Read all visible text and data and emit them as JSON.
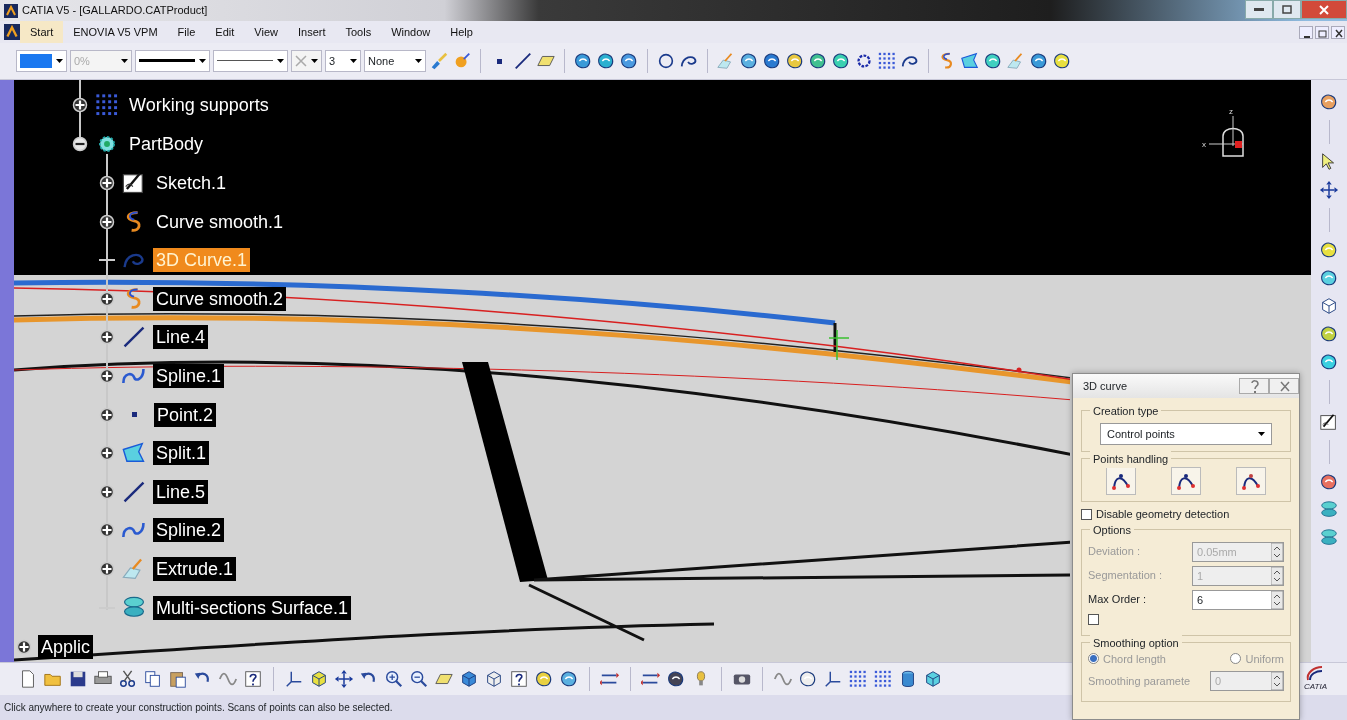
{
  "window": {
    "title": "CATIA V5 - [GALLARDO.CATProduct]"
  },
  "menu": [
    {
      "label": "Start",
      "selected": true
    },
    {
      "label": "ENOVIA V5 VPM",
      "selected": false
    },
    {
      "label": "File",
      "selected": false
    },
    {
      "label": "Edit",
      "selected": false
    },
    {
      "label": "View",
      "selected": false
    },
    {
      "label": "Insert",
      "selected": false
    },
    {
      "label": "Tools",
      "selected": false
    },
    {
      "label": "Window",
      "selected": false
    },
    {
      "label": "Help",
      "selected": false
    }
  ],
  "toolbar": {
    "transparency": "0%",
    "line_weight": "3",
    "layer": "None"
  },
  "tree": {
    "nodes": [
      {
        "label": "Working supports",
        "kind": "grid",
        "expandable": true,
        "expanded": false,
        "selected": false
      },
      {
        "label": "PartBody",
        "kind": "body",
        "expandable": true,
        "expanded": true,
        "selected": false,
        "children": [
          {
            "label": "Sketch.1",
            "kind": "sketch",
            "expandable": true,
            "expanded": false,
            "selected": false
          },
          {
            "label": "Curve smooth.1",
            "kind": "smooth",
            "expandable": true,
            "expanded": false,
            "selected": false
          },
          {
            "label": "3D Curve.1",
            "kind": "curve",
            "expandable": false,
            "expanded": false,
            "selected": true
          },
          {
            "label": "Curve smooth.2",
            "kind": "smooth",
            "expandable": true,
            "expanded": false,
            "selected": false
          },
          {
            "label": "Line.4",
            "kind": "line",
            "expandable": true,
            "expanded": false,
            "selected": false
          },
          {
            "label": "Spline.1",
            "kind": "spline",
            "expandable": true,
            "expanded": false,
            "selected": false
          },
          {
            "label": "Point.2",
            "kind": "point",
            "expandable": true,
            "expanded": false,
            "selected": false
          },
          {
            "label": "Split.1",
            "kind": "split",
            "expandable": true,
            "expanded": false,
            "selected": false
          },
          {
            "label": "Line.5",
            "kind": "line",
            "expandable": true,
            "expanded": false,
            "selected": false
          },
          {
            "label": "Spline.2",
            "kind": "spline",
            "expandable": true,
            "expanded": false,
            "selected": false
          },
          {
            "label": "Extrude.1",
            "kind": "extrude",
            "expandable": true,
            "expanded": false,
            "selected": false
          },
          {
            "label": "Multi-sections Surface.1",
            "kind": "loft",
            "expandable": false,
            "expanded": false,
            "selected": false
          }
        ]
      }
    ],
    "root_nodes": [
      {
        "label": "Applic",
        "expandable": true,
        "expanded": false,
        "selected": false
      }
    ]
  },
  "compass": {
    "axes": [
      "z",
      "x"
    ]
  },
  "dialog": {
    "title": "3D curve",
    "creation_type": {
      "legend": "Creation type",
      "value": "Control points"
    },
    "points_handling": {
      "legend": "Points handling"
    },
    "detection": {
      "label": "Disable geometry detection",
      "checked": false
    },
    "options": {
      "legend": "Options",
      "fields": [
        {
          "label": "Deviation :",
          "value": "0.05mm",
          "disabled": true
        },
        {
          "label": "Segmentation :",
          "value": "1",
          "disabled": true
        },
        {
          "label": "Max Order :",
          "value": "6",
          "disabled": false
        }
      ],
      "checkbox": {
        "checked": false
      }
    },
    "smoothing": {
      "legend": "Smoothing option",
      "radios": [
        {
          "label": "Chord length",
          "selected": true,
          "disabled": true
        },
        {
          "label": "Uniform",
          "selected": false,
          "disabled": true
        }
      ],
      "field": {
        "label": "Smoothing paramete",
        "value": "0",
        "disabled": true
      }
    }
  },
  "logo": {
    "text": "CATIA"
  },
  "status_bar": "Click anywhere to create your construction points. Scans of points can also be selected."
}
